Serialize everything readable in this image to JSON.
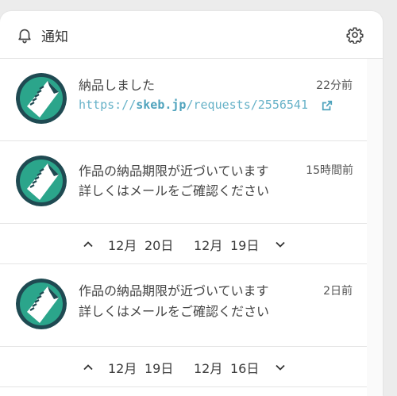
{
  "header": {
    "title": "通知",
    "bell_icon": "bell-icon",
    "settings_icon": "gear-icon"
  },
  "colors": {
    "link": "#67b2c8",
    "avatar_teal": "#2ba58b",
    "avatar_dark": "#1f4a52"
  },
  "notifications": [
    {
      "message": "納品しました",
      "time": "22分前",
      "link_prefix": "https://",
      "link_domain": "skeb.jp",
      "link_path": "/requests/2556541"
    },
    {
      "message": "作品の納品期限が近づいています",
      "time": "15時間前",
      "detail": "詳しくはメールをご確認ください"
    },
    {
      "message": "作品の納品期限が近づいています",
      "time": "2日前",
      "detail": "詳しくはメールをご確認ください"
    }
  ],
  "pagers": [
    {
      "month_a": "12月",
      "day_a": "20日",
      "month_b": "12月",
      "day_b": "19日"
    },
    {
      "month_a": "12月",
      "day_a": "19日",
      "month_b": "12月",
      "day_b": "16日"
    }
  ]
}
